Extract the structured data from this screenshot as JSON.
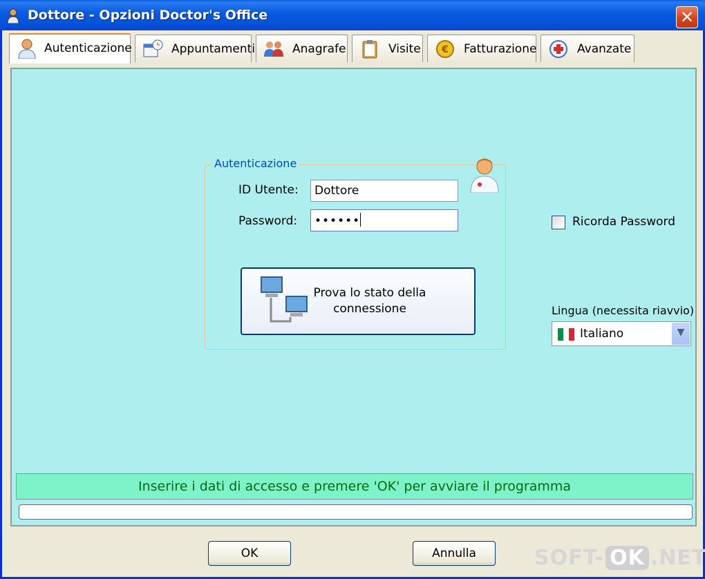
{
  "window": {
    "title": "Dottore - Opzioni Doctor's Office",
    "close_glyph": "✕"
  },
  "tabs": [
    {
      "label": "Autenticazione",
      "icon": "doctor-icon",
      "active": true
    },
    {
      "label": "Appuntamenti",
      "icon": "calendar-clock-icon",
      "active": false
    },
    {
      "label": "Anagrafe",
      "icon": "people-icon",
      "active": false
    },
    {
      "label": "Visite",
      "icon": "clipboard-icon",
      "active": false
    },
    {
      "label": "Fatturazione",
      "icon": "euro-coin-icon",
      "active": false
    },
    {
      "label": "Avanzate",
      "icon": "medkit-icon",
      "active": false
    }
  ],
  "auth": {
    "group_title": "Autenticazione",
    "user_label": "ID Utente:",
    "user_value": "Dottore",
    "password_label": "Password:",
    "password_value": "••••••",
    "test_button_label": "Prova lo stato della connessione"
  },
  "remember": {
    "label": "Ricorda Password",
    "checked": false
  },
  "language": {
    "label": "Lingua (necessita riavvio)",
    "selected": "Italiano",
    "flag_colors": [
      "#009246",
      "#ffffff",
      "#ce2b37"
    ]
  },
  "status": {
    "message": "Inserire i dati di accesso e premere 'OK' per avviare il programma",
    "progress": 0
  },
  "buttons": {
    "ok": "OK",
    "cancel": "Annulla"
  },
  "watermark": {
    "prefix": "SOFT-",
    "badge": "OK",
    "suffix": ".NET"
  },
  "colors": {
    "title_bar": "#0a5ce0",
    "panel_bg": "#aeeeee",
    "status_bg": "#7ef2c8",
    "status_text": "#046b12",
    "group_title": "#0046d5"
  }
}
